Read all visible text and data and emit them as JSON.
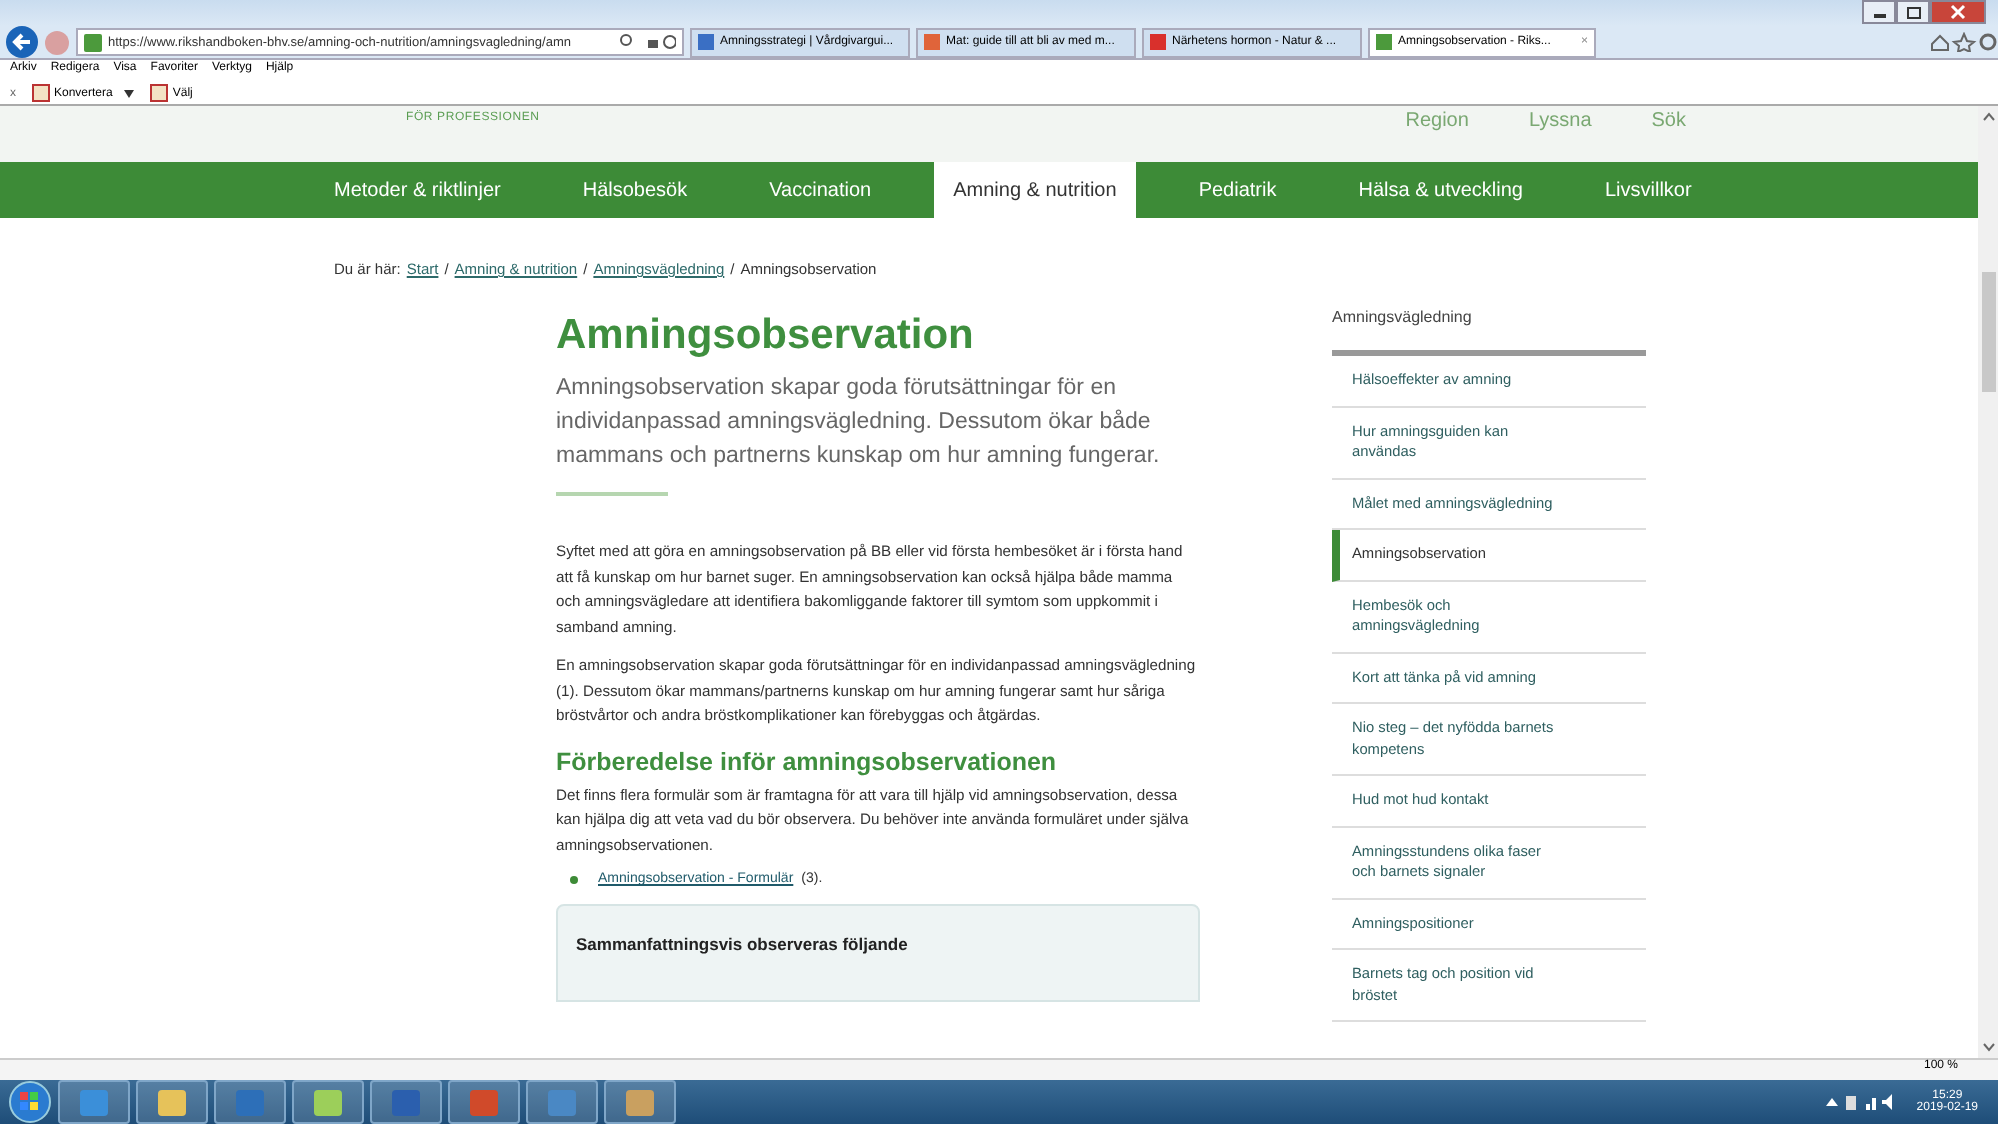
{
  "browser": {
    "address": "https://www.rikshandboken-bhv.se/amning-och-nutrition/amningsvagledning/amn",
    "tabs": [
      {
        "label": "Amningsstrategi | Vårdgivargui...",
        "selected": false,
        "color": "#3a6fc4"
      },
      {
        "label": "Mat: guide till att bli av med m...",
        "selected": false,
        "color": "#e0643a"
      },
      {
        "label": "Närhetens hormon - Natur & ...",
        "selected": false,
        "color": "#d9302c"
      },
      {
        "label": "Amningsobservation - Riks...",
        "selected": true,
        "color": "#4c9a3c"
      }
    ],
    "close_tab": "×",
    "menu": [
      "Arkiv",
      "Redigera",
      "Visa",
      "Favoriter",
      "Verktyg",
      "Hjälp"
    ],
    "toolbar": {
      "close": "x",
      "items": [
        "Konvertera",
        "Välj"
      ]
    }
  },
  "header": {
    "tagline": "FÖR PROFESSIONEN",
    "links": [
      "Region",
      "Lyssna",
      "Sök"
    ]
  },
  "nav": [
    {
      "label": "Metoder & riktlinjer",
      "selected": false
    },
    {
      "label": "Hälsobesök",
      "selected": false
    },
    {
      "label": "Vaccination",
      "selected": false
    },
    {
      "label": "Amning & nutrition",
      "selected": true
    },
    {
      "label": "Pediatrik",
      "selected": false
    },
    {
      "label": "Hälsa & utveckling",
      "selected": false
    },
    {
      "label": "Livsvillkor",
      "selected": false
    }
  ],
  "breadcrumb": {
    "prefix": "Du är här:",
    "links": [
      "Start",
      "Amning & nutrition",
      "Amningsvägledning"
    ],
    "current": "Amningsobservation",
    "separator": "/"
  },
  "article": {
    "title": "Amningsobservation",
    "lead": "Amningsobservation skapar goda förutsättningar för en individanpassad amningsvägledning. Dessutom ökar både mammans och partnerns kunskap om hur amning fungerar.",
    "paragraphs": [
      "Syftet med att göra en amningsobservation på BB eller vid första hembesöket är i första hand att få kunskap om hur barnet suger. En amningsobservation kan också hjälpa både mamma och amningsvägledare att identifiera bakomliggande faktorer till symtom som uppkommit i samband amning.",
      "En amningsobservation skapar goda förutsättningar för en individanpassad amningsvägledning (1). Dessutom ökar mammans/partnerns kunskap om hur amning fungerar samt hur såriga bröstvårtor och andra bröstkomplikationer kan förebyggas och åtgärdas."
    ],
    "section": {
      "heading": "Förberedelse inför amningsobservationen",
      "text": "Det finns flera formulär som är framtagna för att vara till hjälp vid amningsobservation, dessa kan hjälpa dig att veta vad du bör observera. Du behöver inte använda formuläret under själva amningsobservationen.",
      "list": [
        {
          "link": "Amningsobservation - Formulär",
          "suffix": "(3)."
        }
      ]
    },
    "box": {
      "title": "Sammanfattningsvis observeras följande"
    }
  },
  "sidebar": {
    "title": "Amningsvägledning",
    "items": [
      {
        "label": "Hälsoeffekter av amning",
        "selected": false
      },
      {
        "label": "Hur amningsguiden kan användas",
        "selected": false
      },
      {
        "label": "Målet med amningsvägledning",
        "selected": false
      },
      {
        "label": "Amningsobservation",
        "selected": true
      },
      {
        "label": "Hembesök och amningsvägledning",
        "selected": false
      },
      {
        "label": "Kort att tänka på vid amning",
        "selected": false
      },
      {
        "label": "Nio steg – det nyfödda barnets kompetens",
        "selected": false
      },
      {
        "label": "Hud mot hud kontakt",
        "selected": false
      },
      {
        "label": "Amningsstundens olika faser och barnets signaler",
        "selected": false
      },
      {
        "label": "Amningspositioner",
        "selected": false
      },
      {
        "label": "Barnets tag och position vid bröstet",
        "selected": false
      }
    ]
  },
  "status_bar": {
    "zoom": "100 %"
  },
  "taskbar": {
    "time": "15:29",
    "date": "2019-02-19"
  }
}
